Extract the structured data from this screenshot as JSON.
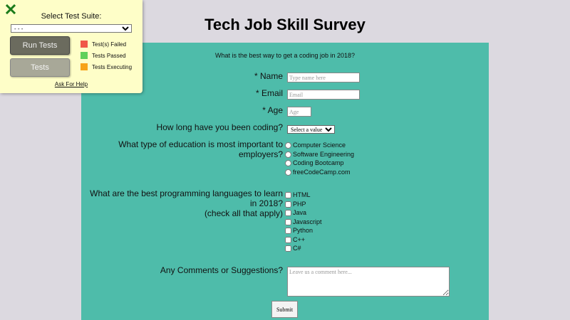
{
  "page": {
    "title": "Tech Job Skill Survey"
  },
  "form": {
    "description": "What is the best way to get a coding job in 2018?",
    "name": {
      "label": "* Name",
      "placeholder": "Type name here"
    },
    "email": {
      "label": "* Email",
      "placeholder": "Email"
    },
    "age": {
      "label": "* Age",
      "placeholder": "Age"
    },
    "coding_duration": {
      "label": "How long have you been coding?",
      "selected": "Select a value"
    },
    "education": {
      "label": "What type of education is most important to employers?",
      "options": [
        "Computer Science",
        "Software Engineering",
        "Coding Bootcamp",
        "freeCodeCamp.com"
      ]
    },
    "languages": {
      "label": "What are the best programming languages to learn in 2018?",
      "sublabel": "(check all that apply)",
      "options": [
        "HTML",
        "PHP",
        "Java",
        "Javascript",
        "Python",
        "C++",
        "C#"
      ]
    },
    "comments": {
      "label": "Any Comments or Suggestions?",
      "placeholder": "Leave us a comment here..."
    },
    "submit_label": "Submit"
  },
  "test_panel": {
    "suite_label": "Select Test Suite:",
    "suite_selected": "- - -",
    "run_tests_label": "Run Tests",
    "tests_label": "Tests",
    "legend": [
      {
        "label": "Test(s) Failed",
        "color": "#f0574a"
      },
      {
        "label": "Tests Passed",
        "color": "#5fd05a"
      },
      {
        "label": "Tests Executing",
        "color": "#f7a318"
      }
    ],
    "help_label": "Ask For Help",
    "close_icon_color": "#1a7a1a"
  }
}
